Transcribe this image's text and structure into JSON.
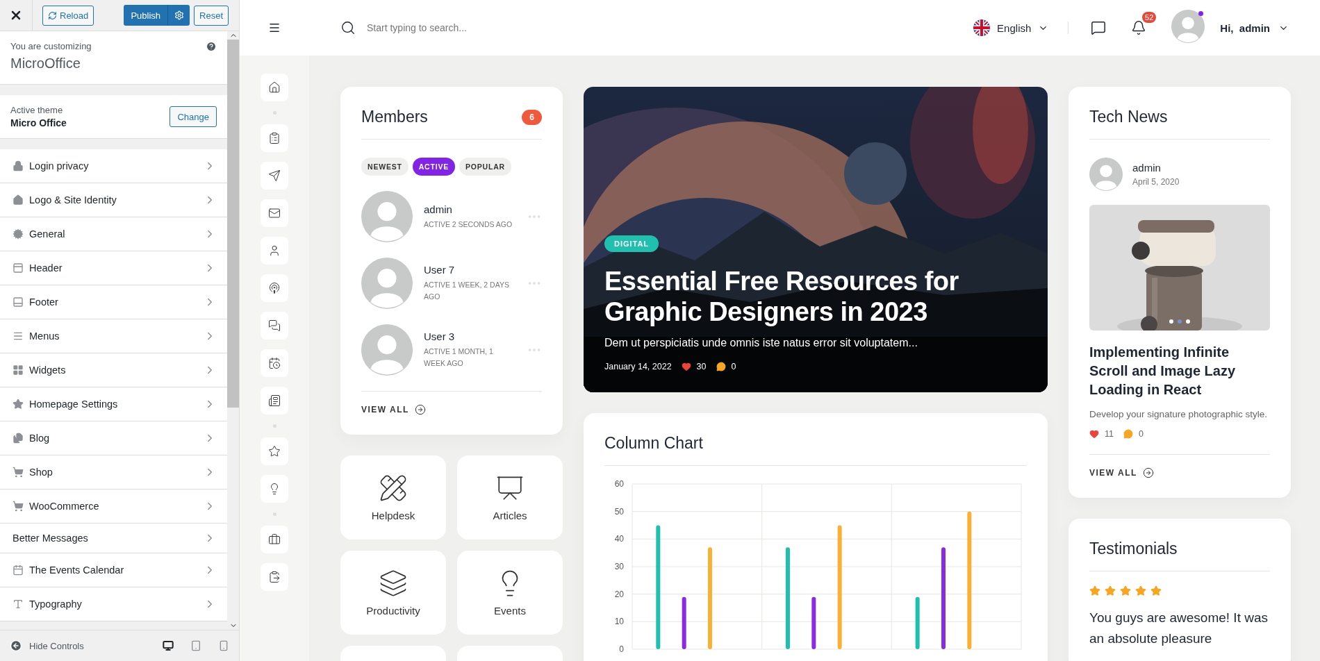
{
  "customizer": {
    "buttons": {
      "reload": "Reload",
      "publish": "Publish",
      "reset": "Reset"
    },
    "customizing_label": "You are customizing",
    "site_name": "MicroOffice",
    "active_theme_label": "Active theme",
    "theme_name": "Micro Office",
    "change_button": "Change",
    "sections": [
      {
        "label": "Login privacy",
        "kind": "lock"
      },
      {
        "label": "Logo & Site Identity",
        "kind": "home"
      },
      {
        "label": "General",
        "kind": "gear"
      },
      {
        "label": "Header",
        "kind": "header"
      },
      {
        "label": "Footer",
        "kind": "footer"
      },
      {
        "label": "Menus",
        "kind": "menu"
      },
      {
        "label": "Widgets",
        "kind": "widgets"
      },
      {
        "label": "Homepage Settings",
        "kind": "star"
      },
      {
        "label": "Blog",
        "kind": "blog"
      },
      {
        "label": "Shop",
        "kind": "cart"
      },
      {
        "label": "WooCommerce",
        "kind": "cart"
      },
      {
        "label": "Better Messages",
        "kind": "plain"
      },
      {
        "label": "The Events Calendar",
        "kind": "calendar"
      },
      {
        "label": "Typography",
        "kind": "type"
      }
    ],
    "hide_controls": "Hide Controls",
    "devices": [
      {
        "selected": true
      },
      {
        "selected": false
      },
      {
        "selected": false
      }
    ]
  },
  "header": {
    "search": {
      "placeholder": "Start typing to search..."
    },
    "language": "English",
    "notifications": "52",
    "greeting": "Hi,  admin"
  },
  "members": {
    "title": "Members",
    "count": "6",
    "tabs": [
      {
        "label": "NEWEST",
        "selected": false
      },
      {
        "label": "ACTIVE",
        "selected": true
      },
      {
        "label": "POPULAR",
        "selected": false
      }
    ],
    "list": [
      {
        "name": "admin",
        "activity": "ACTIVE 2 SECONDS AGO"
      },
      {
        "name": "User 7",
        "activity": "ACTIVE 1 WEEK, 2 DAYS AGO"
      },
      {
        "name": "User 3",
        "activity": "ACTIVE 1 MONTH, 1 WEEK AGO"
      }
    ],
    "view_all": "VIEW ALL"
  },
  "shortcuts": [
    {
      "label": "Helpdesk"
    },
    {
      "label": "Articles"
    },
    {
      "label": "Productivity"
    },
    {
      "label": "Events"
    }
  ],
  "hero": {
    "tag": "DIGITAL",
    "title": "Essential Free Resources for Graphic Designers in 2023",
    "excerpt": "Dem ut perspiciatis unde omnis iste natus error sit voluptatem...",
    "date": "January 14, 2022",
    "likes": "30",
    "comments": "0"
  },
  "chart": {
    "title": "Column Chart",
    "chart_data": {
      "type": "bar",
      "grid": true,
      "ylim": [
        0,
        60
      ],
      "yticks": [
        0,
        10,
        20,
        30,
        40,
        50,
        60
      ],
      "series": [
        {
          "color": "#20bfae",
          "values": [
            45,
            37,
            19
          ]
        },
        {
          "color": "#8a2be2",
          "values": [
            19,
            19,
            37
          ]
        },
        {
          "color": "#fbb034",
          "values": [
            37,
            45,
            50
          ]
        }
      ]
    }
  },
  "tech_news": {
    "title": "Tech News",
    "author": "admin",
    "date": "April 5, 2020",
    "slides": [
      {
        "selected": false
      },
      {
        "selected": true
      },
      {
        "selected": false
      }
    ],
    "headline": "Implementing Infinite Scroll and Image Lazy Loading in React",
    "excerpt": "Develop your signature photographic style.",
    "likes": "11",
    "comments": "0",
    "view_all": "VIEW ALL"
  },
  "testimonials": {
    "title": "Testimonials",
    "stars": 5,
    "quote": "You guys are awesome! It was an absolute pleasure"
  }
}
